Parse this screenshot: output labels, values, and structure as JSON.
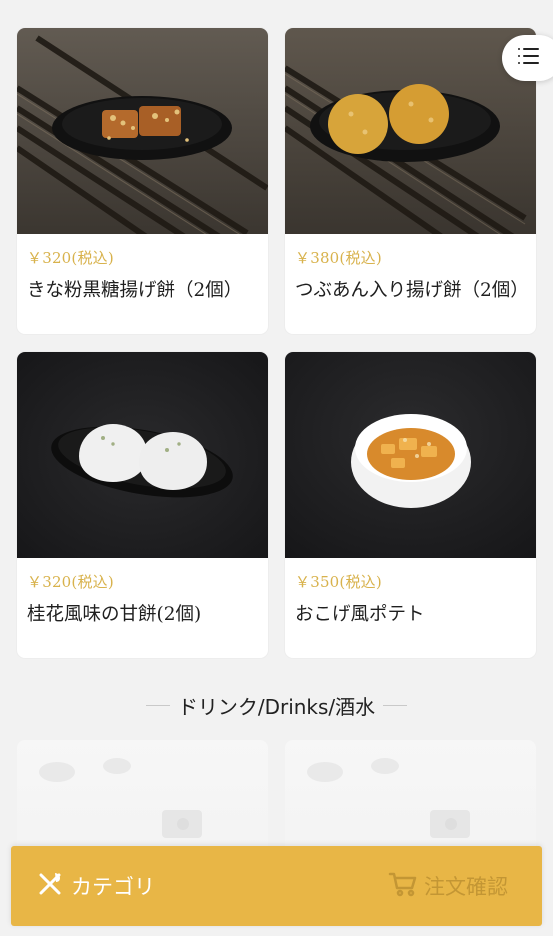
{
  "menu": {
    "items": [
      {
        "price": "￥320(税込)",
        "name": "きな粉黒糖揚げ餅（2個）"
      },
      {
        "price": "￥380(税込)",
        "name": "つぶあん入り揚げ餅（2個）"
      },
      {
        "price": "￥320(税込)",
        "name": "桂花風味の甘餅(2個)"
      },
      {
        "price": "￥350(税込)",
        "name": "おこげ風ポテト"
      }
    ]
  },
  "section": {
    "title": "ドリンク/Drinks/酒水"
  },
  "bottom_bar": {
    "category_label": "カテゴリ",
    "order_label": "注文確認"
  },
  "icons": {
    "menu": "list-menu-icon",
    "category": "fork-knife-icon",
    "order": "cart-icon"
  },
  "colors": {
    "accent": "#e8b646",
    "price": "#d8b24c"
  }
}
